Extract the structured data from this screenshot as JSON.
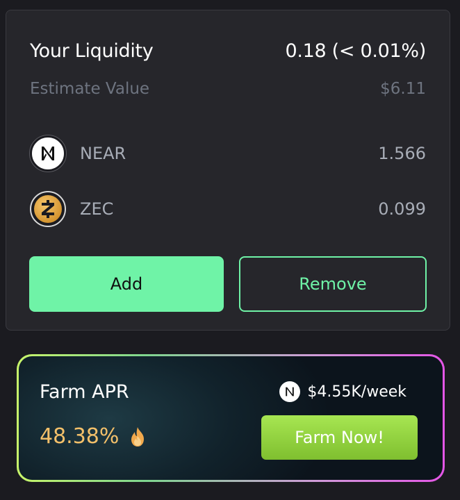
{
  "liquidity": {
    "title": "Your Liquidity",
    "share": "0.18 (< 0.01%)",
    "estimate_label": "Estimate Value",
    "estimate_value": "$6.11",
    "tokens": [
      {
        "symbol": "NEAR",
        "amount": "1.566",
        "icon": "near-logo-icon"
      },
      {
        "symbol": "ZEC",
        "amount": "0.099",
        "icon": "zcash-logo-icon"
      }
    ],
    "add_label": "Add",
    "remove_label": "Remove"
  },
  "farm": {
    "title": "Farm APR",
    "apr": "48.38%",
    "reward": "$4.55K/week",
    "button_label": "Farm Now!"
  },
  "colors": {
    "accent_green": "#6ff3a7",
    "apr_gold": "#f3c06a",
    "farm_button": "#8fd13a"
  }
}
